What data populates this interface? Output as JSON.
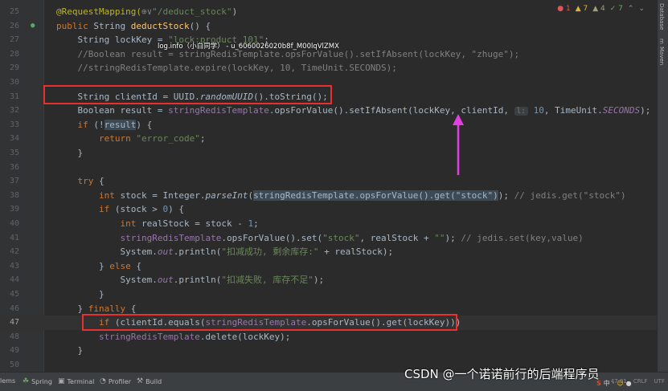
{
  "editor": {
    "lines": [
      {
        "num": "25",
        "tokens": [
          {
            "t": "@RequestMapping(",
            "c": "t-ann"
          },
          {
            "t": "⊕∨",
            "c": "t-cmt"
          },
          {
            "t": "\"/deduct_stock\"",
            "c": "t-str"
          },
          {
            "t": ")",
            "c": ""
          }
        ]
      },
      {
        "num": "26",
        "gutter": "run",
        "tokens": [
          {
            "t": "public ",
            "c": "t-kw"
          },
          {
            "t": "String ",
            "c": ""
          },
          {
            "t": "deductStock",
            "c": "t-fn"
          },
          {
            "t": "() {",
            "c": ""
          }
        ]
      },
      {
        "num": "27",
        "tokens": [
          {
            "t": "    String lockKey = ",
            "c": ""
          },
          {
            "t": "\"lock:product_101\"",
            "c": "t-str"
          },
          {
            "t": ";",
            "c": ""
          }
        ]
      },
      {
        "num": "28",
        "tokens": [
          {
            "t": "    //Boolean result = stringRedisTemplate.opsForValue().setIfAbsent(lockKey, \"zhuge\");",
            "c": "t-cmt"
          }
        ]
      },
      {
        "num": "29",
        "tokens": [
          {
            "t": "    //stringRedisTemplate.expire(lockKey, 10, TimeUnit.SECONDS);",
            "c": "t-cmt"
          }
        ]
      },
      {
        "num": "30",
        "tokens": []
      },
      {
        "num": "31",
        "tokens": [
          {
            "t": "    String clientId = UUID.",
            "c": ""
          },
          {
            "t": "randomUUID",
            "c": "t-it"
          },
          {
            "t": "().toString();",
            "c": ""
          }
        ]
      },
      {
        "num": "32",
        "tokens": [
          {
            "t": "    Boolean result = ",
            "c": ""
          },
          {
            "t": "stringRedisTemplate",
            "c": "t-fld"
          },
          {
            "t": ".opsForValue().setIfAbsent(lockKey, clientId, ",
            "c": ""
          },
          {
            "t": "l:",
            "c": "t-hint"
          },
          {
            "t": " ",
            "c": ""
          },
          {
            "t": "10",
            "c": "t-num"
          },
          {
            "t": ", TimeUnit.",
            "c": ""
          },
          {
            "t": "SECONDS",
            "c": "t-fld-i"
          },
          {
            "t": ");",
            "c": ""
          }
        ]
      },
      {
        "num": "33",
        "tokens": [
          {
            "t": "    ",
            "c": ""
          },
          {
            "t": "if ",
            "c": "t-kw"
          },
          {
            "t": "(!",
            "c": ""
          },
          {
            "t": "result",
            "c": "t-hl"
          },
          {
            "t": ") {",
            "c": ""
          }
        ]
      },
      {
        "num": "34",
        "tokens": [
          {
            "t": "        ",
            "c": ""
          },
          {
            "t": "return ",
            "c": "t-kw"
          },
          {
            "t": "\"error_code\"",
            "c": "t-str"
          },
          {
            "t": ";",
            "c": ""
          }
        ]
      },
      {
        "num": "35",
        "tokens": [
          {
            "t": "    }",
            "c": ""
          }
        ]
      },
      {
        "num": "36",
        "tokens": []
      },
      {
        "num": "37",
        "tokens": [
          {
            "t": "    ",
            "c": ""
          },
          {
            "t": "try ",
            "c": "t-kw"
          },
          {
            "t": "{",
            "c": ""
          }
        ]
      },
      {
        "num": "38",
        "tokens": [
          {
            "t": "        ",
            "c": ""
          },
          {
            "t": "int ",
            "c": "t-kw"
          },
          {
            "t": "stock = Integer.",
            "c": ""
          },
          {
            "t": "parseInt",
            "c": "t-it"
          },
          {
            "t": "(",
            "c": ""
          },
          {
            "t": "stringRedisTemplate.opsForValue().get(\"stock\")",
            "c": "t-hl"
          },
          {
            "t": "); ",
            "c": ""
          },
          {
            "t": "// jedis.get(\"stock\")",
            "c": "t-cmt"
          }
        ]
      },
      {
        "num": "39",
        "tokens": [
          {
            "t": "        ",
            "c": ""
          },
          {
            "t": "if ",
            "c": "t-kw"
          },
          {
            "t": "(stock > ",
            "c": ""
          },
          {
            "t": "0",
            "c": "t-num"
          },
          {
            "t": ") {",
            "c": ""
          }
        ]
      },
      {
        "num": "40",
        "tokens": [
          {
            "t": "            ",
            "c": ""
          },
          {
            "t": "int ",
            "c": "t-kw"
          },
          {
            "t": "realStock = stock - ",
            "c": ""
          },
          {
            "t": "1",
            "c": "t-num"
          },
          {
            "t": ";",
            "c": ""
          }
        ]
      },
      {
        "num": "41",
        "tokens": [
          {
            "t": "            ",
            "c": ""
          },
          {
            "t": "stringRedisTemplate",
            "c": "t-fld"
          },
          {
            "t": ".opsForValue().set(",
            "c": ""
          },
          {
            "t": "\"stock\"",
            "c": "t-str"
          },
          {
            "t": ", realStock + ",
            "c": ""
          },
          {
            "t": "\"\"",
            "c": "t-str"
          },
          {
            "t": "); ",
            "c": ""
          },
          {
            "t": "// jedis.set(key,value)",
            "c": "t-cmt"
          }
        ]
      },
      {
        "num": "42",
        "tokens": [
          {
            "t": "            System.",
            "c": ""
          },
          {
            "t": "out",
            "c": "t-fld-i"
          },
          {
            "t": ".println(",
            "c": ""
          },
          {
            "t": "\"扣减成功, 剩余库存:\"",
            "c": "t-str"
          },
          {
            "t": " + realStock);",
            "c": ""
          }
        ]
      },
      {
        "num": "43",
        "tokens": [
          {
            "t": "        } ",
            "c": ""
          },
          {
            "t": "else ",
            "c": "t-kw"
          },
          {
            "t": "{",
            "c": ""
          }
        ]
      },
      {
        "num": "44",
        "tokens": [
          {
            "t": "            System.",
            "c": ""
          },
          {
            "t": "out",
            "c": "t-fld-i"
          },
          {
            "t": ".println(",
            "c": ""
          },
          {
            "t": "\"扣减失败, 库存不足\"",
            "c": "t-str"
          },
          {
            "t": ");",
            "c": ""
          }
        ]
      },
      {
        "num": "45",
        "tokens": [
          {
            "t": "        }",
            "c": ""
          }
        ]
      },
      {
        "num": "46",
        "tokens": [
          {
            "t": "    } ",
            "c": ""
          },
          {
            "t": "finally ",
            "c": "t-kw"
          },
          {
            "t": "{",
            "c": ""
          }
        ]
      },
      {
        "num": "47",
        "caret": true,
        "tokens": [
          {
            "t": "        ",
            "c": ""
          },
          {
            "t": "if ",
            "c": "t-kw"
          },
          {
            "t": "(clientId.equals(",
            "c": ""
          },
          {
            "t": "stringRedisTemplate",
            "c": "t-fld"
          },
          {
            "t": ".opsForValue().get(lockKey)))",
            "c": ""
          }
        ]
      },
      {
        "num": "48",
        "tokens": [
          {
            "t": "        ",
            "c": ""
          },
          {
            "t": "stringRedisTemplate",
            "c": "t-fld"
          },
          {
            "t": ".delete(lockKey);",
            "c": ""
          }
        ]
      },
      {
        "num": "49",
        "tokens": [
          {
            "t": "    }",
            "c": ""
          }
        ]
      },
      {
        "num": "50",
        "tokens": []
      }
    ]
  },
  "overlay_text": "log.info（小白同学） - u_6060026020b8f_M00lqVlZMX",
  "inspections": {
    "errors": "1",
    "warnings": "7",
    "weak": "4",
    "typos": "7"
  },
  "right_strip": [
    "Database",
    "m",
    "Maven"
  ],
  "bottom_tools": [
    {
      "label": "lems",
      "icon": ""
    },
    {
      "label": "Spring",
      "icon": "☘"
    },
    {
      "label": "Terminal",
      "icon": "▣"
    },
    {
      "label": "Profiler",
      "icon": "◔"
    },
    {
      "label": "Build",
      "icon": "⚒"
    }
  ],
  "status": {
    "position": "47:01",
    "line_sep": "CRLF",
    "encoding": "UTF"
  },
  "watermark": "CSDN @一个诺诺前行的后端程序员",
  "colors": {
    "annotation_box": "#e8302f",
    "arrow": "#e040e0",
    "editor_bg": "#2b2b2b"
  }
}
